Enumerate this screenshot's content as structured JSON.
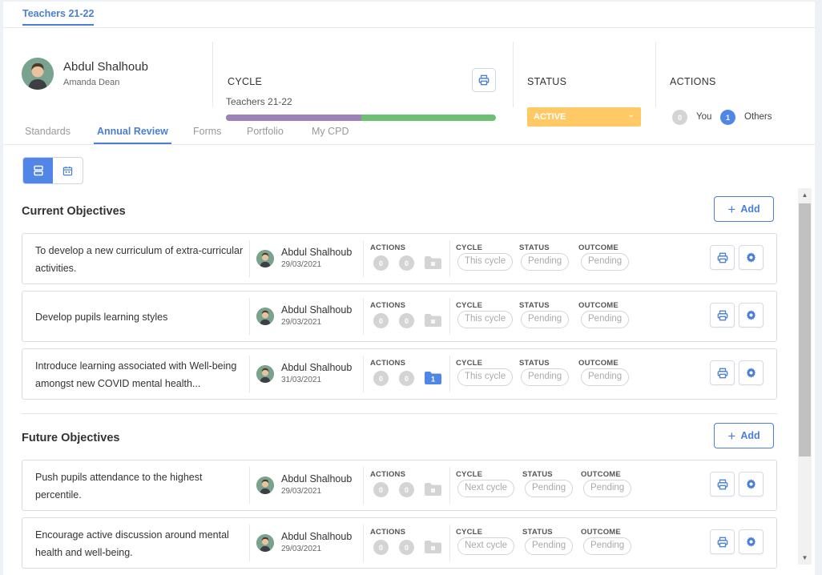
{
  "top_tab": "Teachers 21-22",
  "profile": {
    "name": "Abdul Shalhoub",
    "subtitle": "Amanda Dean"
  },
  "cycle": {
    "heading": "CYCLE",
    "name": "Teachers 21-22",
    "progress": 0.5,
    "colors": {
      "done": "#9c82b8",
      "remaining": "#6dbf73"
    }
  },
  "status": {
    "heading": "STATUS",
    "value": "ACTIVE",
    "color": "#ffca66"
  },
  "actions": {
    "heading": "ACTIONS",
    "you_count": "0",
    "you_label": "You",
    "others_count": "1",
    "others_label": "Others"
  },
  "tabs": [
    "Standards",
    "Annual Review",
    "Forms",
    "Portfolio",
    "My CPD"
  ],
  "active_tab": "Annual Review",
  "sections": {
    "current": {
      "title": "Current Objectives",
      "add_label": "Add"
    },
    "future": {
      "title": "Future Objectives",
      "add_label": "Add"
    }
  },
  "column_labels": {
    "actions": "ACTIONS",
    "cycle": "CYCLE",
    "status": "STATUS",
    "outcome": "OUTCOME"
  },
  "objectives": [
    {
      "title": "To develop a new curriculum of extra-curricular activities.",
      "owner": "Abdul Shalhoub",
      "date": "29/03/2021",
      "action_counts": [
        "0",
        "0"
      ],
      "files": "",
      "cycle": "This cycle",
      "status": "Pending",
      "outcome": "Pending"
    },
    {
      "title": "Develop pupils learning styles",
      "owner": "Abdul Shalhoub",
      "date": "29/03/2021",
      "action_counts": [
        "0",
        "0"
      ],
      "files": "",
      "cycle": "This cycle",
      "status": "Pending",
      "outcome": "Pending"
    },
    {
      "title": "Introduce learning associated with Well-being amongst new COVID mental health...",
      "owner": "Abdul Shalhoub",
      "date": "31/03/2021",
      "action_counts": [
        "0",
        "0"
      ],
      "files": "1",
      "cycle": "This cycle",
      "status": "Pending",
      "outcome": "Pending"
    },
    {
      "title": "Push pupils attendance to the highest percentile.",
      "owner": "Abdul Shalhoub",
      "date": "29/03/2021",
      "action_counts": [
        "0",
        "0"
      ],
      "files": "",
      "cycle": "Next cycle",
      "status": "Pending",
      "outcome": "Pending"
    },
    {
      "title": "Encourage active discussion around mental health and well-being.",
      "owner": "Abdul Shalhoub",
      "date": "29/03/2021",
      "action_counts": [
        "0",
        "0"
      ],
      "files": "",
      "cycle": "Next cycle",
      "status": "Pending",
      "outcome": "Pending"
    }
  ],
  "colors": {
    "accent": "#4a7fd4",
    "toggle_active": "#4f86e8",
    "badge_grey": "#d4d4d4",
    "badge_blue": "#4f86e8"
  }
}
